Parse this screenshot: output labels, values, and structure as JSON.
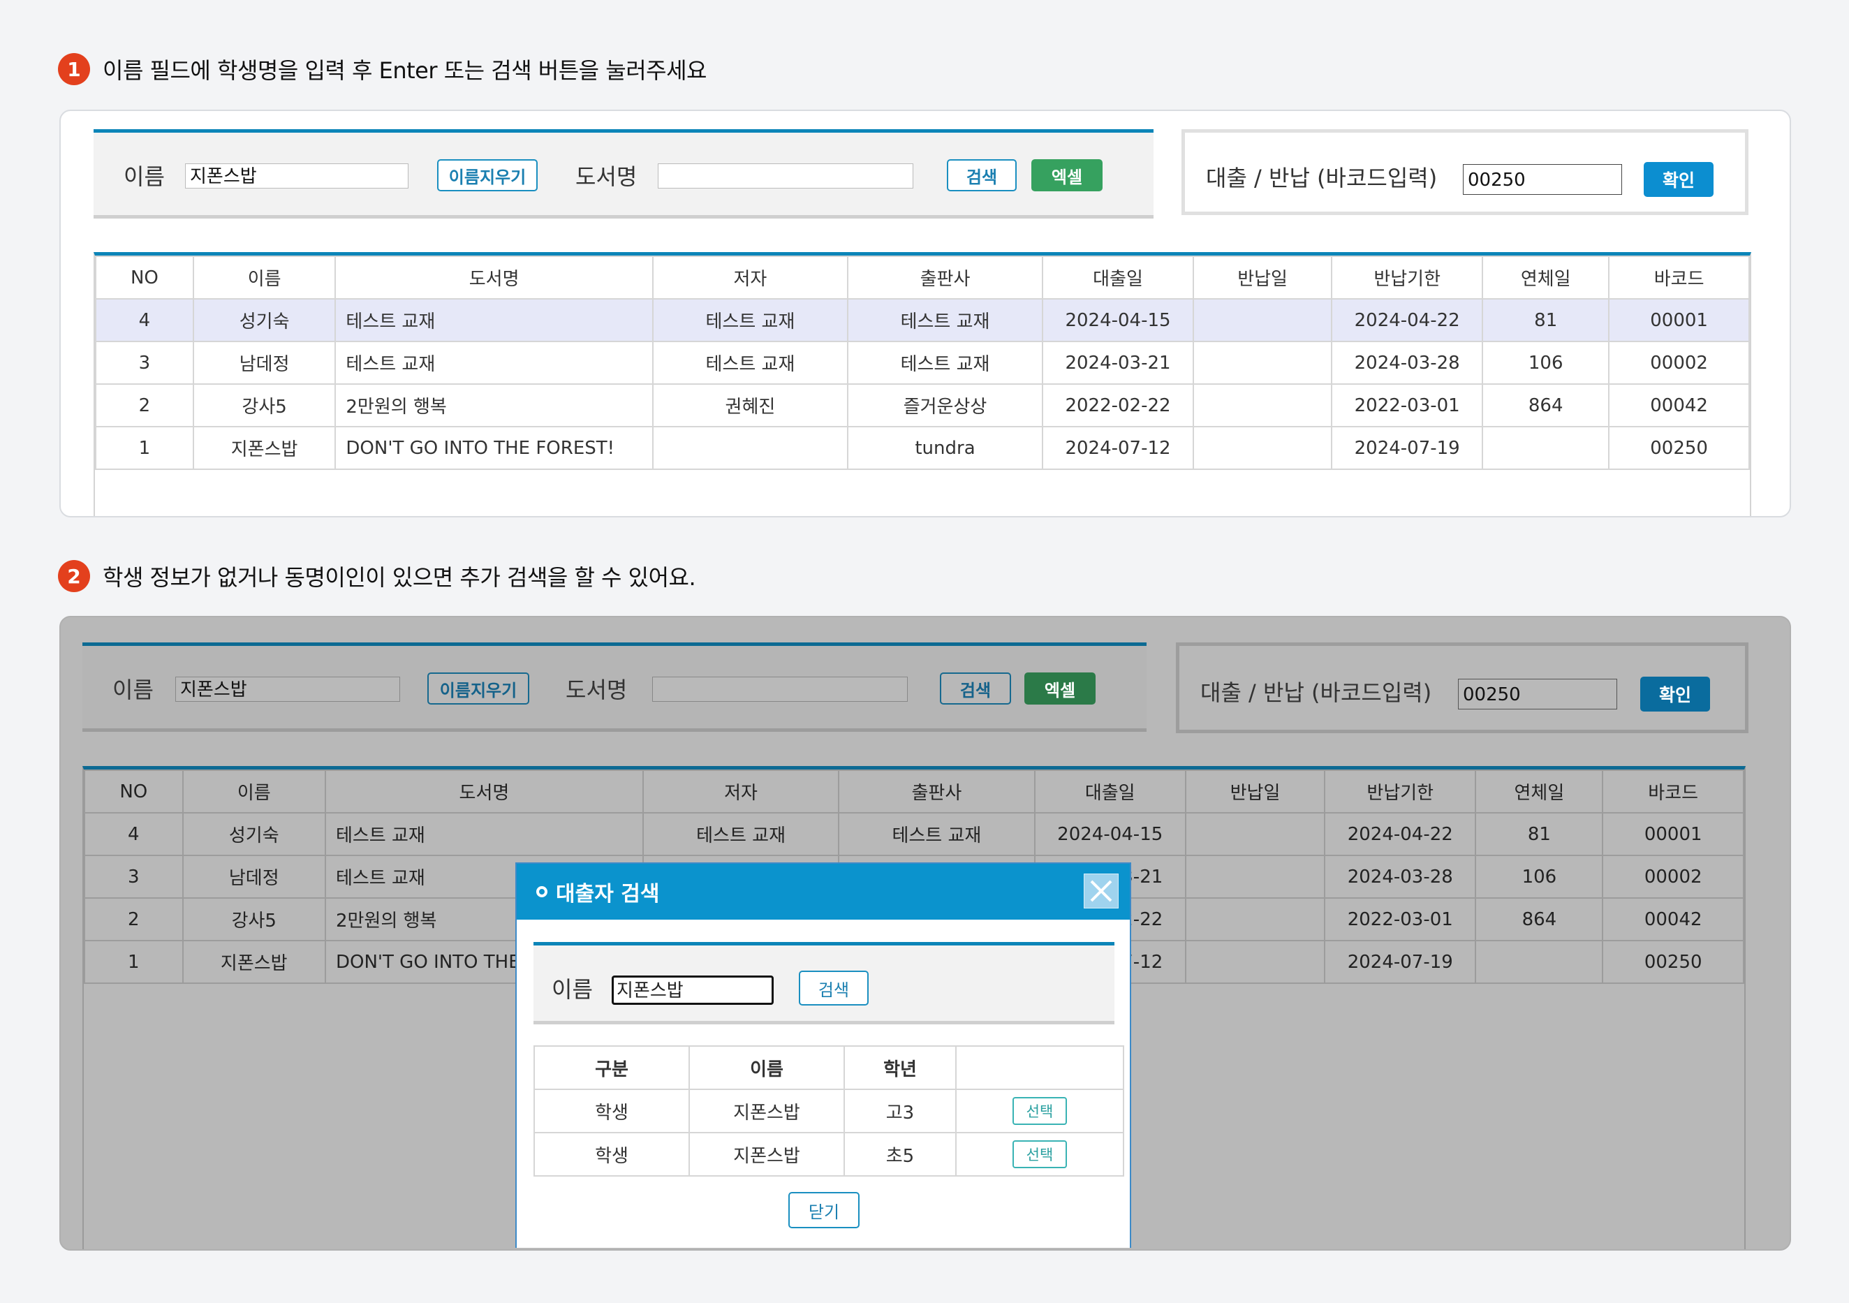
{
  "step1": {
    "number": "1",
    "text": "이름 필드에 학생명을 입력 후 Enter 또는 검색 버튼을 눌러주세요"
  },
  "step2": {
    "number": "2",
    "text": "학생 정보가 없거나 동명이인이 있으면 추가 검색을 할 수 있어요."
  },
  "search": {
    "name_label": "이름",
    "name_value": "지폰스밥",
    "clear_label": "이름지우기",
    "book_label": "도서명",
    "book_value": "",
    "search_label": "검색",
    "excel_label": "엑셀"
  },
  "barcode": {
    "label": "대출 / 반납 (바코드입력)",
    "value": "00250",
    "confirm_label": "확인"
  },
  "table": {
    "headers": [
      "NO",
      "이름",
      "도서명",
      "저자",
      "출판사",
      "대출일",
      "반납일",
      "반납기한",
      "연체일",
      "바코드"
    ],
    "rows": [
      [
        "4",
        "성기숙",
        "테스트 교재",
        "테스트 교재",
        "테스트 교재",
        "2024-04-15",
        "",
        "2024-04-22",
        "81",
        "00001"
      ],
      [
        "3",
        "남데정",
        "테스트 교재",
        "테스트 교재",
        "테스트 교재",
        "2024-03-21",
        "",
        "2024-03-28",
        "106",
        "00002"
      ],
      [
        "2",
        "강사5",
        "2만원의 행복",
        "권혜진",
        "즐거운상상",
        "2022-02-22",
        "",
        "2022-03-01",
        "864",
        "00042"
      ],
      [
        "1",
        "지폰스밥",
        "DON'T GO INTO THE FOREST!",
        "",
        "tundra",
        "2024-07-12",
        "",
        "2024-07-19",
        "",
        "00250"
      ]
    ],
    "obscured_rows": [
      [
        "4",
        "성기숙",
        "테스트 교재",
        "테스트 교재",
        "테스트 교재",
        "2024-04-15",
        "",
        "2024-04-22",
        "81",
        "00001"
      ],
      [
        "3",
        "남데정",
        "테스트 교재",
        "",
        "",
        "1",
        "",
        "2024-03-28",
        "106",
        "00002"
      ],
      [
        "2",
        "강사5",
        "2만원의 행복",
        "",
        "",
        "2",
        "",
        "2022-03-01",
        "864",
        "00042"
      ],
      [
        "1",
        "지폰스밥",
        "DON'T GO INTO THE F",
        "",
        "",
        "2",
        "",
        "2024-07-19",
        "",
        "00250"
      ]
    ]
  },
  "modal": {
    "title": "대출자 검색",
    "name_label": "이름",
    "name_value": "지폰스밥",
    "search_label": "검색",
    "headers": [
      "구분",
      "이름",
      "학년",
      ""
    ],
    "rows": [
      {
        "type": "학생",
        "name": "지폰스밥",
        "grade": "고3",
        "action": "선택"
      },
      {
        "type": "학생",
        "name": "지폰스밥",
        "grade": "초5",
        "action": "선택"
      }
    ],
    "close_label": "닫기"
  },
  "colors": {
    "accent": "#0b93cd",
    "step_badge": "#e3401d",
    "excel": "#36a15f",
    "selected_row": "#e6e8f8"
  }
}
